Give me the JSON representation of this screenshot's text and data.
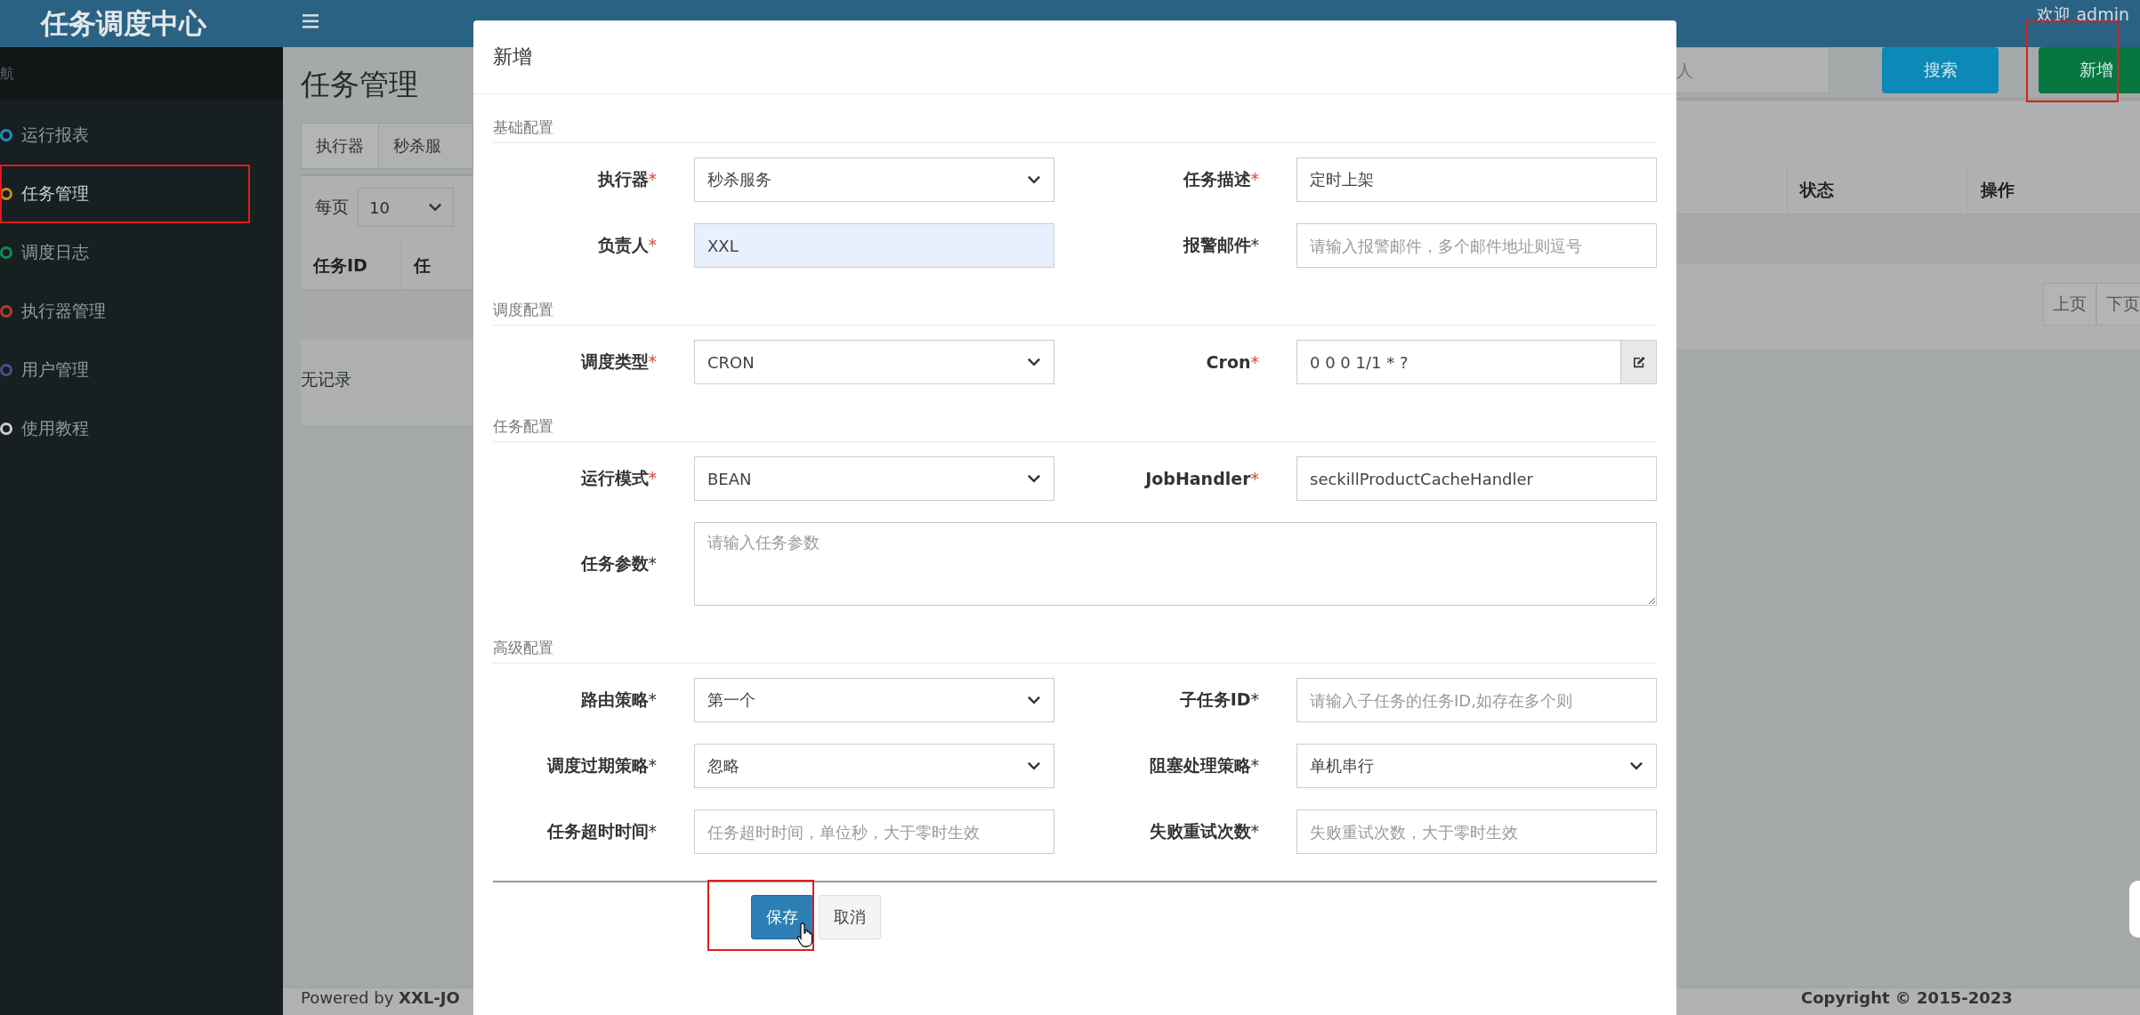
{
  "header": {
    "logo": "任务调度中心",
    "user": "欢迎 admin"
  },
  "sidebar": {
    "section": "航",
    "items": [
      {
        "label": "运行报表",
        "color": "#1f8fc0",
        "selected": false,
        "highlighted": false
      },
      {
        "label": "任务管理",
        "color": "#c9871c",
        "selected": true,
        "highlighted": true
      },
      {
        "label": "调度日志",
        "color": "#128a58",
        "selected": false,
        "highlighted": false
      },
      {
        "label": "执行器管理",
        "color": "#b8392f",
        "selected": false,
        "highlighted": false
      },
      {
        "label": "用户管理",
        "color": "#4a4f8c",
        "selected": false,
        "highlighted": false
      },
      {
        "label": "使用教程",
        "color": "#cccccc",
        "selected": false,
        "highlighted": false
      }
    ]
  },
  "page": {
    "title": "任务管理",
    "filter": {
      "addon": "执行器",
      "select_value": "秒杀服",
      "search_placeholder": "人",
      "buttons": [
        {
          "label": "搜索",
          "kind": "search",
          "highlighted": false
        },
        {
          "label": "新增",
          "kind": "add",
          "highlighted": true
        }
      ]
    },
    "page_size_label": "每页",
    "page_size": "10",
    "table": {
      "columns_left": [
        "任务ID",
        "任"
      ],
      "columns_right": [
        "状态",
        "操作"
      ],
      "empty_text": "无记录"
    },
    "pager": [
      "上页",
      "下页"
    ]
  },
  "footer": {
    "left": "Powered by **XXL-JO**",
    "right": "Copyright © 2015-2023"
  },
  "dialog": {
    "title": "新增",
    "sections": [
      {
        "title": "基础配置",
        "fields": [
          {
            "label": "执行器",
            "mark": "*",
            "mark_red": true,
            "kind": "select",
            "value": "秒杀服务"
          },
          {
            "label": "任务描述",
            "mark": "*",
            "mark_red": true,
            "kind": "input",
            "value": "定时上架"
          },
          {
            "label": "负责人",
            "mark": "*",
            "mark_red": true,
            "kind": "input",
            "value": "XXL",
            "autofilled": true
          },
          {
            "label": "报警邮件",
            "mark": "*",
            "mark_red": false,
            "kind": "input",
            "placeholder": "请输入报警邮件，多个邮件地址则逗号"
          }
        ]
      },
      {
        "title": "调度配置",
        "fields": [
          {
            "label": "调度类型",
            "mark": "*",
            "mark_red": true,
            "kind": "select",
            "value": "CRON"
          },
          {
            "label": "Cron",
            "mark": "*",
            "mark_red": true,
            "kind": "input-button",
            "value": "0 0 0 1/1 * ?"
          }
        ]
      },
      {
        "title": "任务配置",
        "fields": [
          {
            "label": "运行模式",
            "mark": "*",
            "mark_red": true,
            "kind": "select",
            "value": "BEAN"
          },
          {
            "label": "JobHandler",
            "mark": "*",
            "mark_red": true,
            "kind": "input",
            "value": "seckillProductCacheHandler"
          },
          {
            "label": "任务参数",
            "mark": "*",
            "mark_red": false,
            "kind": "textarea",
            "placeholder": "请输入任务参数"
          }
        ]
      },
      {
        "title": "高级配置",
        "fields": [
          {
            "label": "路由策略",
            "mark": "*",
            "mark_red": false,
            "kind": "select",
            "value": "第一个"
          },
          {
            "label": "子任务ID",
            "mark": "*",
            "mark_red": false,
            "kind": "input",
            "placeholder": "请输入子任务的任务ID,如存在多个则"
          },
          {
            "label": "调度过期策略",
            "mark": "*",
            "mark_red": false,
            "kind": "select",
            "value": "忽略"
          },
          {
            "label": "阻塞处理策略",
            "mark": "*",
            "mark_red": false,
            "kind": "select",
            "value": "单机串行"
          },
          {
            "label": "任务超时时间",
            "mark": "*",
            "mark_red": false,
            "kind": "input",
            "placeholder": "任务超时时间，单位秒，大于零时生效"
          },
          {
            "label": "失败重试次数",
            "mark": "*",
            "mark_red": false,
            "kind": "input",
            "placeholder": "失败重试次数，大于零时生效"
          }
        ]
      }
    ],
    "buttons": [
      {
        "label": "保存",
        "kind": "primary",
        "highlighted": true
      },
      {
        "label": "取消",
        "kind": "default",
        "highlighted": false
      }
    ]
  }
}
